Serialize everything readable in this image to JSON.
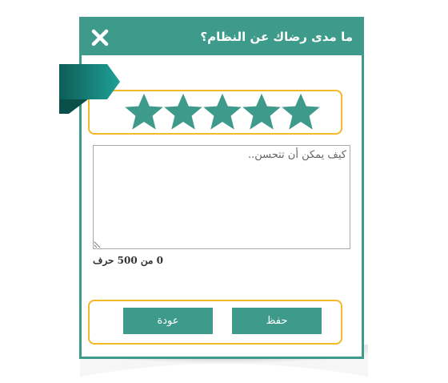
{
  "dialog": {
    "title": "ما مدى رضاك عن النظام؟",
    "close_icon": "close-x-icon"
  },
  "rating": {
    "value": 5,
    "max": 5,
    "star_icon": "star-icon",
    "star_color": "#3e9a8a",
    "frame_color": "#f2b929"
  },
  "comment": {
    "placeholder": "كيف يمكن أن تتحسن..",
    "value": ""
  },
  "counter": {
    "text": "0 من 500 حرف"
  },
  "buttons": {
    "save_label": "حفظ",
    "back_label": "عودة"
  },
  "colors": {
    "accent": "#3e9a8a",
    "highlight": "#f2b929"
  }
}
